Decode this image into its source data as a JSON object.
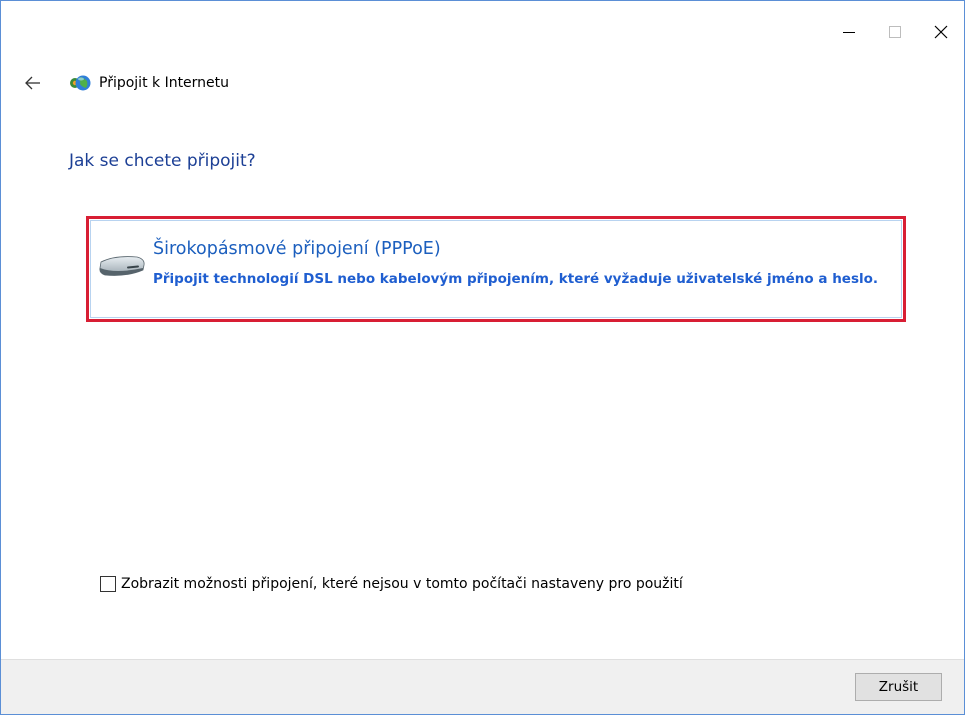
{
  "wizard": {
    "title": "Připojit k Internetu",
    "icon": "network-globe-icon"
  },
  "window_controls": {
    "minimize_icon": "minimize-icon",
    "maximize_icon": "maximize-icon",
    "close_icon": "close-icon"
  },
  "navigation": {
    "back_icon": "back-arrow-icon"
  },
  "question": "Jak se chcete připojit?",
  "options": [
    {
      "icon": "broadband-modem-icon",
      "title": "Širokopásmové připojení (PPPoE)",
      "description": "Připojit technologií DSL nebo kabelovým připojením, které vyžaduje uživatelské jméno a heslo."
    }
  ],
  "show_options_checkbox": {
    "label": "Zobrazit možnosti připojení, které nejsou v tomto počítači nastaveny pro použití",
    "checked": false
  },
  "footer": {
    "cancel_label": "Zrušit"
  },
  "colors": {
    "heading": "#1c3f95",
    "option_title": "#1c5fbe",
    "option_desc": "#1f5ed0",
    "selection_border": "#d81e34",
    "window_border": "#5b8fd6",
    "footer_bg": "#f0f0f0"
  }
}
